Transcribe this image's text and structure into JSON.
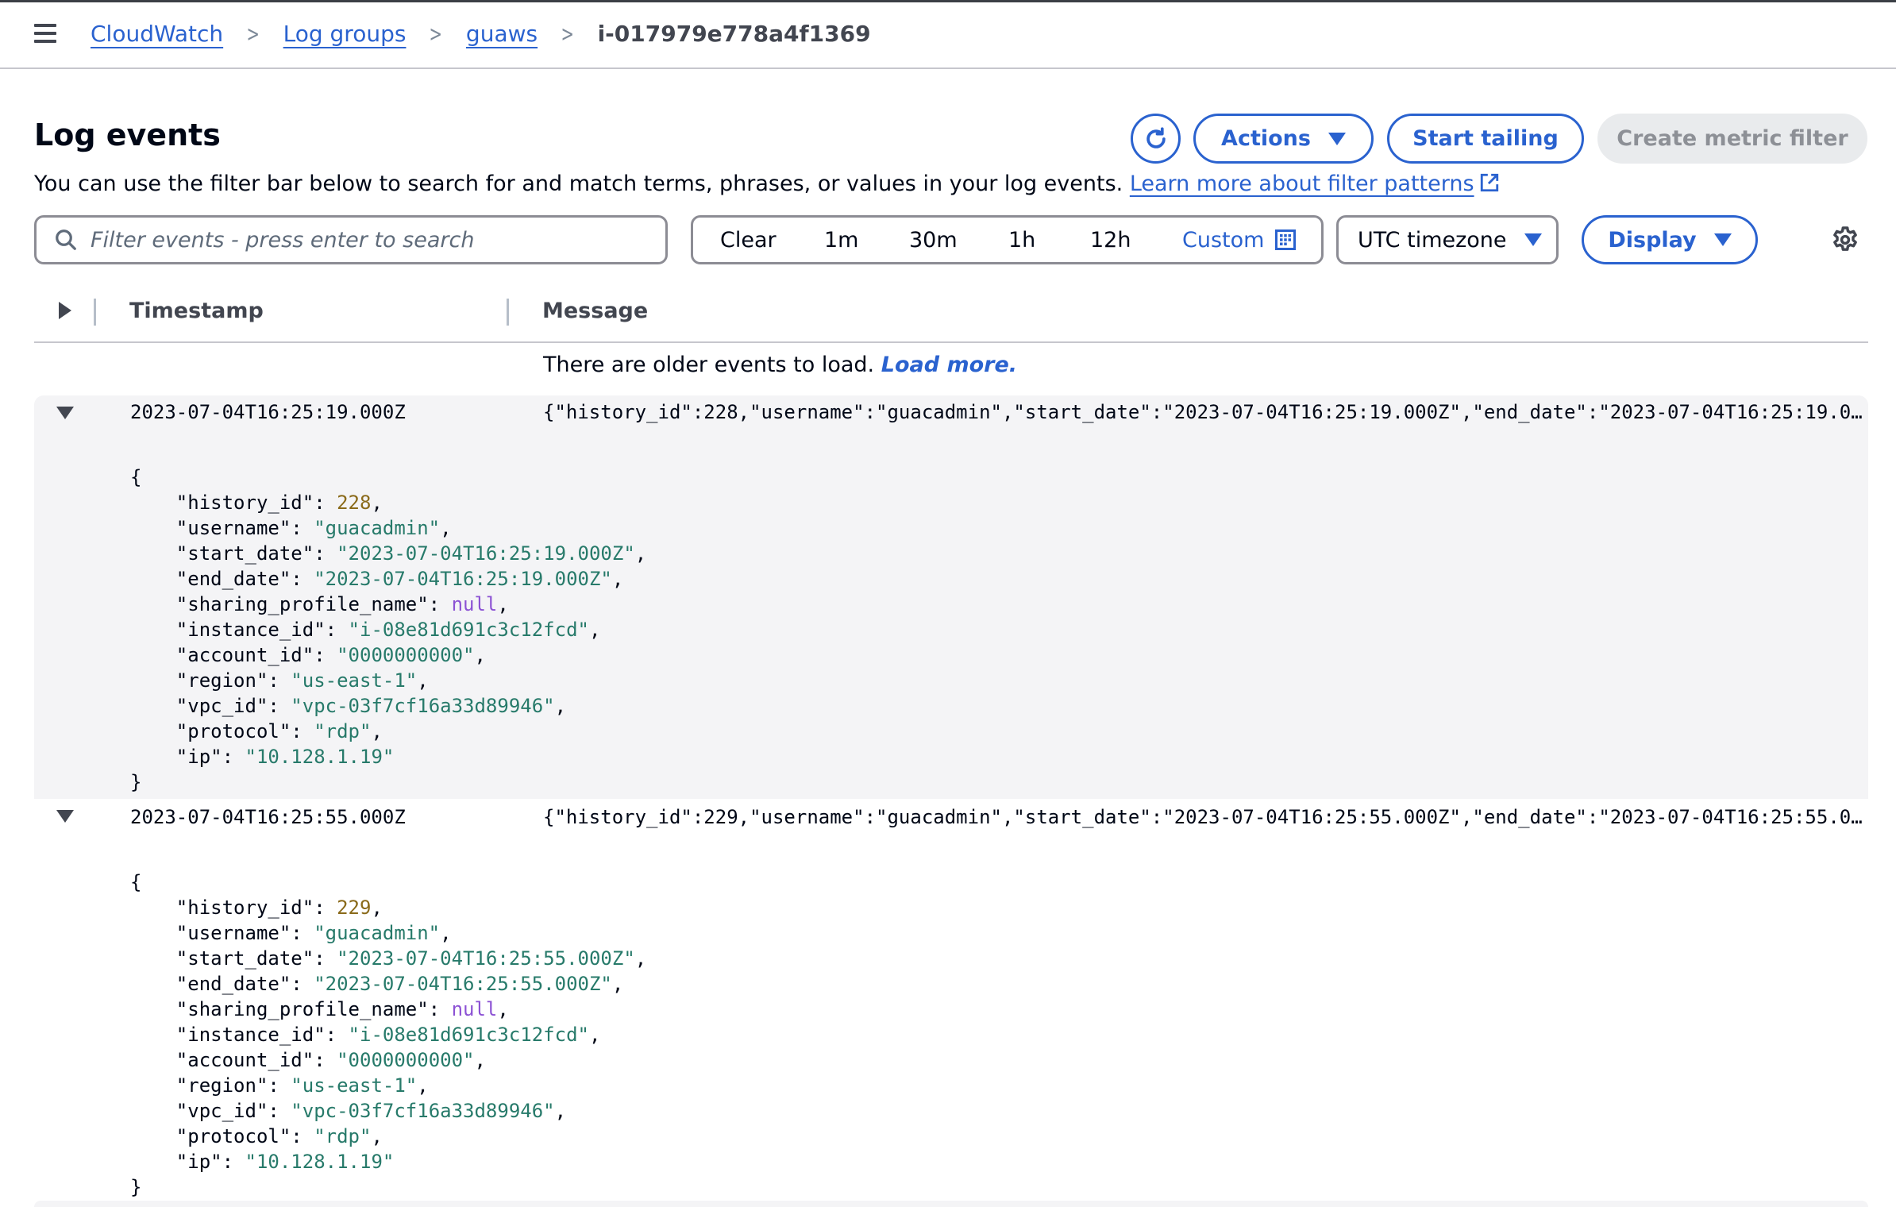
{
  "breadcrumb": {
    "items": [
      {
        "label": "CloudWatch",
        "link": true
      },
      {
        "label": "Log groups",
        "link": true
      },
      {
        "label": "guaws",
        "link": true
      },
      {
        "label": "i-017979e778a4f1369",
        "link": false
      }
    ],
    "separator_icon": "chevron-right-icon",
    "menu_icon": "hamburger-menu-icon"
  },
  "header": {
    "title": "Log events",
    "refresh_icon": "refresh-icon",
    "actions_label": "Actions",
    "start_tailing_label": "Start tailing",
    "create_metric_filter_label": "Create metric filter",
    "description": "You can use the filter bar below to search for and match terms, phrases, or values in your log events.",
    "learn_more_label": "Learn more about filter patterns"
  },
  "filter": {
    "search_placeholder": "Filter events - press enter to search",
    "search_value": "",
    "time_ranges": [
      "Clear",
      "1m",
      "30m",
      "1h",
      "12h"
    ],
    "custom_label": "Custom",
    "timezone_label": "UTC timezone",
    "display_label": "Display"
  },
  "table": {
    "columns": {
      "timestamp": "Timestamp",
      "message": "Message"
    },
    "older_events_text": "There are older events to load.",
    "load_more_label": "Load more."
  },
  "events": [
    {
      "timestamp": "2023-07-04T16:25:19.000Z",
      "message": "{\"history_id\":228,\"username\":\"guacadmin\",\"start_date\":\"2023-07-04T16:25:19.000Z\",\"end_date\":\"2023-07-04T16:25:19.000Z\",\"sharing_profile_name\":null,\"instance_id\":\"i-08e81d691c3c12fcd\",\"account_id\":\"0000000000\",\"region\":\"us-east-1\",\"vpc_id\":\"vpc-03f7cf16a33d89946\",\"protocol\":\"rdp\",\"ip\":\"10.128.1.19\"}",
      "fields": [
        {
          "key": "history_id",
          "value": "228",
          "type": "number"
        },
        {
          "key": "username",
          "value": "guacadmin",
          "type": "string"
        },
        {
          "key": "start_date",
          "value": "2023-07-04T16:25:19.000Z",
          "type": "string"
        },
        {
          "key": "end_date",
          "value": "2023-07-04T16:25:19.000Z",
          "type": "string"
        },
        {
          "key": "sharing_profile_name",
          "value": "null",
          "type": "null"
        },
        {
          "key": "instance_id",
          "value": "i-08e81d691c3c12fcd",
          "type": "string"
        },
        {
          "key": "account_id",
          "value": "0000000000",
          "type": "string"
        },
        {
          "key": "region",
          "value": "us-east-1",
          "type": "string"
        },
        {
          "key": "vpc_id",
          "value": "vpc-03f7cf16a33d89946",
          "type": "string"
        },
        {
          "key": "protocol",
          "value": "rdp",
          "type": "string"
        },
        {
          "key": "ip",
          "value": "10.128.1.19",
          "type": "string"
        }
      ]
    },
    {
      "timestamp": "2023-07-04T16:25:55.000Z",
      "message": "{\"history_id\":229,\"username\":\"guacadmin\",\"start_date\":\"2023-07-04T16:25:55.000Z\",\"end_date\":\"2023-07-04T16:25:55.000Z\",\"sharing_profile_name\":null,\"instance_id\":\"i-08e81d691c3c12fcd\",\"account_id\":\"0000000000\",\"region\":\"us-east-1\",\"vpc_id\":\"vpc-03f7cf16a33d89946\",\"protocol\":\"rdp\",\"ip\":\"10.128.1.19\"}",
      "fields": [
        {
          "key": "history_id",
          "value": "229",
          "type": "number"
        },
        {
          "key": "username",
          "value": "guacadmin",
          "type": "string"
        },
        {
          "key": "start_date",
          "value": "2023-07-04T16:25:55.000Z",
          "type": "string"
        },
        {
          "key": "end_date",
          "value": "2023-07-04T16:25:55.000Z",
          "type": "string"
        },
        {
          "key": "sharing_profile_name",
          "value": "null",
          "type": "null"
        },
        {
          "key": "instance_id",
          "value": "i-08e81d691c3c12fcd",
          "type": "string"
        },
        {
          "key": "account_id",
          "value": "0000000000",
          "type": "string"
        },
        {
          "key": "region",
          "value": "us-east-1",
          "type": "string"
        },
        {
          "key": "vpc_id",
          "value": "vpc-03f7cf16a33d89946",
          "type": "string"
        },
        {
          "key": "protocol",
          "value": "rdp",
          "type": "string"
        },
        {
          "key": "ip",
          "value": "10.128.1.19",
          "type": "string"
        }
      ]
    }
  ],
  "colors": {
    "link": "#2a62cf",
    "json_string": "#277a6a",
    "json_number": "#8a6a1a",
    "json_null": "#8c52d4",
    "expanded_row_bg": "#f4f4f6"
  }
}
